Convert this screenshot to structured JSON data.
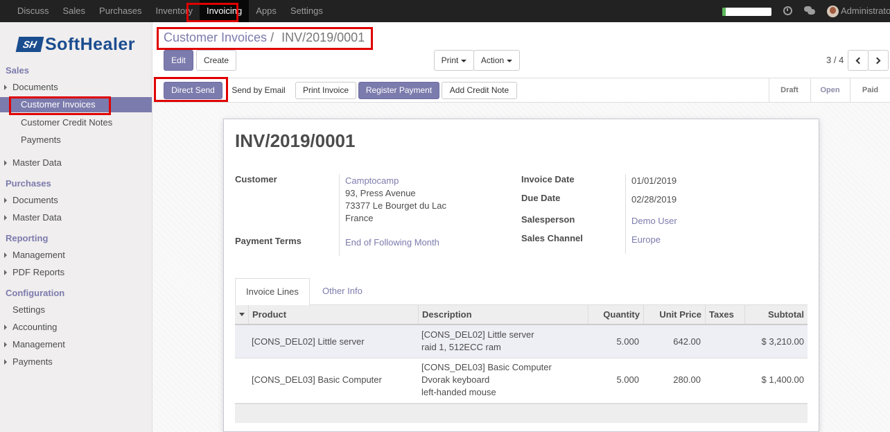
{
  "topbar": {
    "menu": [
      "Discuss",
      "Sales",
      "Purchases",
      "Inventory",
      "Invoicing",
      "Apps",
      "Settings"
    ],
    "active_menu": "Invoicing",
    "user": "Administrator",
    "progress_fraction": 0.07
  },
  "sidebar": {
    "logo_mark": "SH",
    "logo_text": "SoftHealer",
    "sections": [
      {
        "title": "Sales",
        "items": [
          "Documents",
          "Customer Invoices",
          "Customer Credit Notes",
          "Payments",
          "Master Data"
        ]
      },
      {
        "title": "Purchases",
        "items": [
          "Documents",
          "Master Data"
        ]
      },
      {
        "title": "Reporting",
        "items": [
          "Management",
          "PDF Reports"
        ]
      },
      {
        "title": "Configuration",
        "items": [
          "Settings",
          "Accounting",
          "Management",
          "Payments"
        ]
      }
    ]
  },
  "breadcrumb": {
    "parent": "Customer Invoices",
    "separator": "/",
    "current": "INV/2019/0001"
  },
  "controls": {
    "edit": "Edit",
    "create": "Create",
    "print": "Print",
    "action": "Action",
    "pager": "3 / 4"
  },
  "statusbar": {
    "buttons": [
      "Direct Send",
      "Send by Email",
      "Print Invoice",
      "Register Payment",
      "Add Credit Note"
    ],
    "stages": [
      "Draft",
      "Open",
      "Paid"
    ],
    "current_stage": "Open"
  },
  "invoice": {
    "number": "INV/2019/0001",
    "customer_label": "Customer",
    "customer_name": "Camptocamp",
    "customer_address": [
      "93, Press Avenue",
      "73377 Le Bourget du Lac",
      "France"
    ],
    "payment_terms_label": "Payment Terms",
    "payment_terms": "End of Following Month",
    "invoice_date_label": "Invoice Date",
    "invoice_date": "01/01/2019",
    "due_date_label": "Due Date",
    "due_date": "02/28/2019",
    "salesperson_label": "Salesperson",
    "salesperson": "Demo User",
    "sales_channel_label": "Sales Channel",
    "sales_channel": "Europe"
  },
  "tabs": [
    "Invoice Lines",
    "Other Info"
  ],
  "lines": {
    "columns": [
      "Product",
      "Description",
      "Quantity",
      "Unit Price",
      "Taxes",
      "Subtotal"
    ],
    "rows": [
      {
        "product": "[CONS_DEL02] Little server",
        "description": [
          "[CONS_DEL02] Little server",
          "raid 1, 512ECC ram"
        ],
        "quantity": "5.000",
        "unit_price": "642.00",
        "taxes": "",
        "subtotal": "$ 3,210.00"
      },
      {
        "product": "[CONS_DEL03] Basic Computer",
        "description": [
          "[CONS_DEL03] Basic Computer",
          "Dvorak keyboard",
          "left-handed mouse"
        ],
        "quantity": "5.000",
        "unit_price": "280.00",
        "taxes": "",
        "subtotal": "$ 1,400.00"
      }
    ]
  }
}
